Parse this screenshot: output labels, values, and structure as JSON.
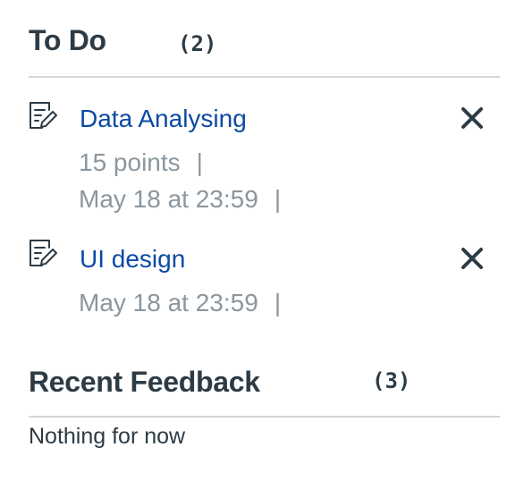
{
  "todo": {
    "title": "To Do",
    "count": "(2)",
    "items": [
      {
        "title": "Data Analysing",
        "points": "15 points",
        "due": "May 18 at 23:59",
        "icon": "assignment-icon",
        "dismiss_icon": "close-icon"
      },
      {
        "title": "UI design",
        "due": "May 18 at 23:59",
        "icon": "assignment-icon",
        "dismiss_icon": "close-icon"
      }
    ],
    "separator": "|"
  },
  "feedback": {
    "title": "Recent Feedback",
    "count": "(3)",
    "empty_text": "Nothing for now"
  },
  "colors": {
    "heading": "#2d3b45",
    "link": "#0b4aa5",
    "muted": "#8b969e",
    "divider": "#d2d6d9"
  }
}
